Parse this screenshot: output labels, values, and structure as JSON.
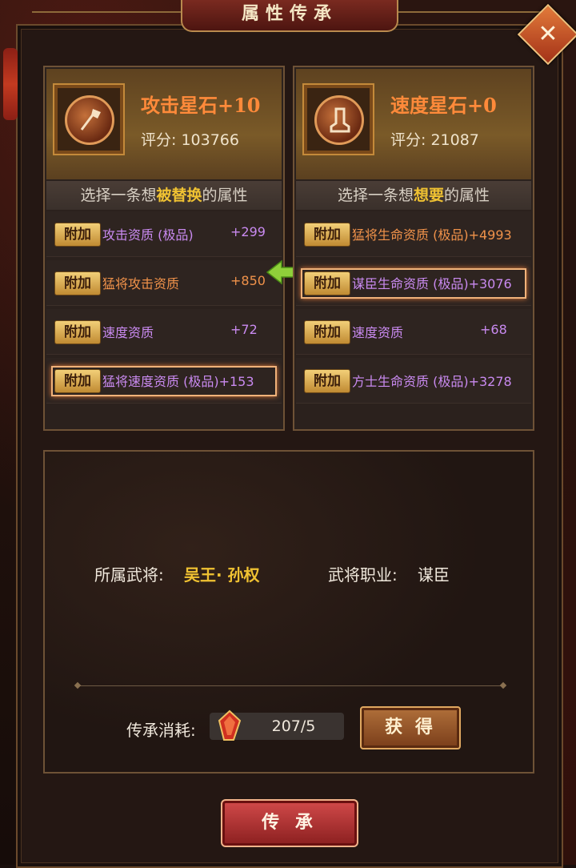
{
  "window": {
    "title": "属性传承",
    "close_icon": "close-icon"
  },
  "left_item": {
    "icon": "axe-icon",
    "name": "攻击星石+10",
    "score": "评分: 103766",
    "prompt_pre": "选择一条想",
    "prompt_hl": "被替换",
    "prompt_post": "的属性",
    "rows": [
      {
        "tag": "附加",
        "attr": "攻击资质 (极品)",
        "value": "+299",
        "color": "purple",
        "selected": false
      },
      {
        "tag": "附加",
        "attr": "猛将攻击资质",
        "value": "+850",
        "color": "orange",
        "selected": false
      },
      {
        "tag": "附加",
        "attr": "速度资质",
        "value": "+72",
        "color": "purple",
        "selected": false
      },
      {
        "tag": "附加",
        "attr": "猛将速度资质 (极品)+153",
        "value": "",
        "color": "purple",
        "selected": true
      }
    ]
  },
  "right_item": {
    "icon": "boot-icon",
    "name": "速度星石+0",
    "score": "评分: 21087",
    "prompt_pre": "选择一条想",
    "prompt_hl": "想要",
    "prompt_post": "的属性",
    "rows": [
      {
        "tag": "附加",
        "attr": "猛将生命资质 (极品)+4993",
        "value": "",
        "color": "orange",
        "selected": false
      },
      {
        "tag": "附加",
        "attr": "谋臣生命资质 (极品)+3076",
        "value": "",
        "color": "purple",
        "selected": true
      },
      {
        "tag": "附加",
        "attr": "速度资质",
        "value": "+68",
        "color": "purple",
        "selected": false
      },
      {
        "tag": "附加",
        "attr": "方士生命资质 (极品)+3278",
        "value": "",
        "color": "purple",
        "selected": false
      }
    ]
  },
  "info": {
    "general_label": "所属武将:",
    "general_value": "吴王· 孙权",
    "profession_label": "武将职业:",
    "profession_value": "谋臣",
    "cost_label": "传承消耗:",
    "cost_value": "207/5",
    "get_button": "获 得"
  },
  "inherit_button": "传 承",
  "colors": {
    "purple": "#c98af0",
    "orange": "#f0924a",
    "highlight": "#f0c232",
    "item_name": "#ff8a3a"
  }
}
